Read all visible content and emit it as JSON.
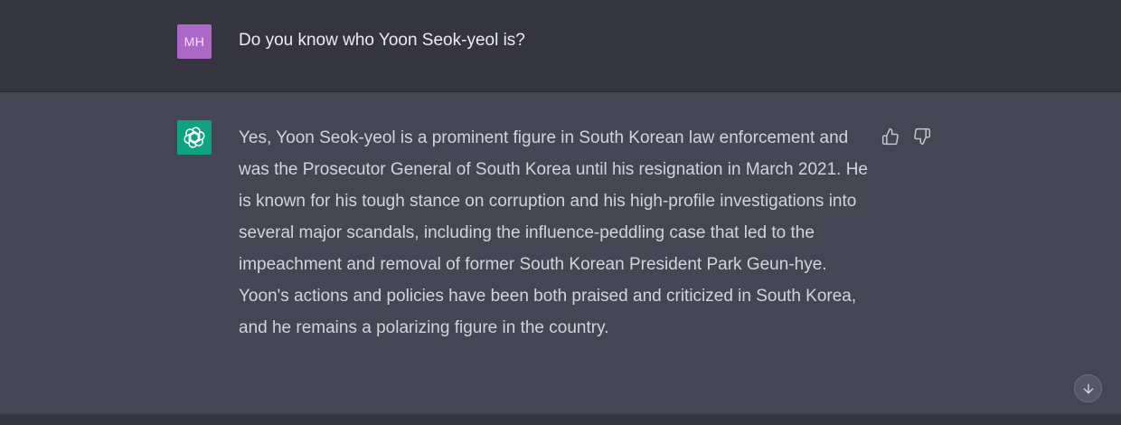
{
  "conversation": {
    "user_message": {
      "avatar_initials": "MH",
      "text": "Do you know who Yoon Seok-yeol is?"
    },
    "assistant_message": {
      "text": "Yes, Yoon Seok-yeol is a prominent figure in South Korean law enforcement and was the Prosecutor General of South Korea until his resignation in March 2021. He is known for his tough stance on corruption and his high-profile investigations into several major scandals, including the influence-peddling case that led to the impeachment and removal of former South Korean President Park Geun-hye. Yoon's actions and policies have been both praised and criticized in South Korea, and he remains a polarizing figure in the country."
    }
  },
  "icons": {
    "assistant_avatar": "openai-logo-icon",
    "thumbs_up": "thumbs-up-icon",
    "thumbs_down": "thumbs-down-icon",
    "scroll_down": "arrow-down-icon"
  },
  "colors": {
    "user_row_bg": "#343541",
    "assistant_row_bg": "#444654",
    "user_avatar_bg": "#ab68c6",
    "assistant_avatar_bg": "#10a37f",
    "text_primary": "#ececf1",
    "text_secondary": "#d1d5db"
  }
}
